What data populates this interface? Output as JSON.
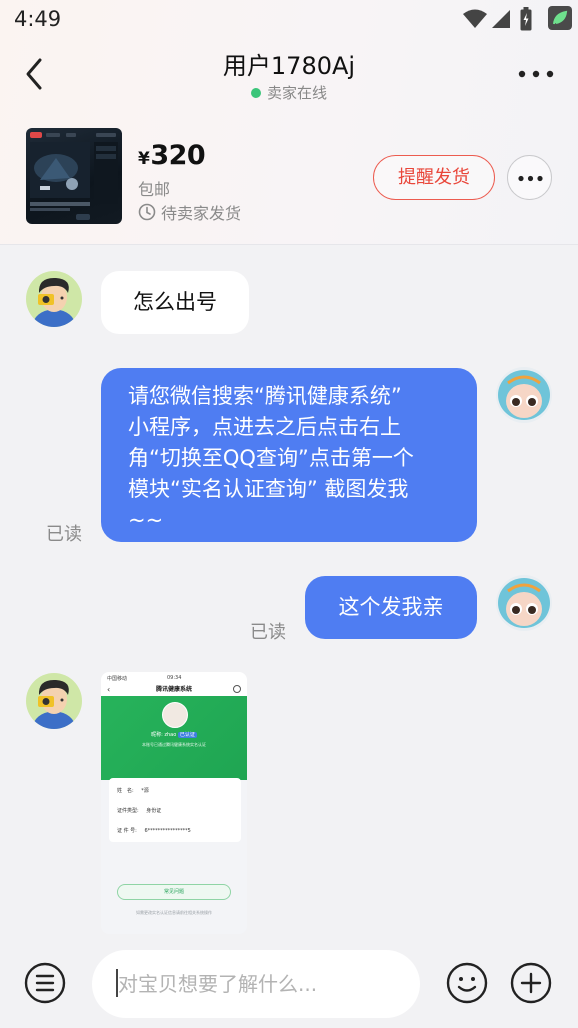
{
  "status_bar": {
    "time": "4:49",
    "icons": [
      "wifi-icon",
      "signal-icon",
      "battery-icon",
      "app-notification-icon"
    ]
  },
  "header": {
    "title": "用户1780Aj",
    "online_status": "卖家在线",
    "online_color": "#3cc57a"
  },
  "product": {
    "currency": "¥",
    "price": "320",
    "shipping": "包邮",
    "status": "待卖家发货",
    "remind_button": "提醒发货",
    "accent": "#e9473b"
  },
  "messages": [
    {
      "from": "seller",
      "type": "text",
      "text": "怎么出号"
    },
    {
      "from": "me",
      "type": "text",
      "lines": [
        "请您微信搜索“腾讯健康系统”",
        "小程序，点进去之后点击右上",
        "角“切换至QQ查询”点击第一个",
        "模块“实名认证查询” 截图发我",
        "~~"
      ],
      "read": "已读"
    },
    {
      "from": "me",
      "type": "text",
      "text": "这个发我亲",
      "read": "已读"
    },
    {
      "from": "seller",
      "type": "image",
      "image": {
        "app_title": "腾讯健康系统",
        "status_time": "09:34",
        "carrier": "中国移动",
        "nickname_label": "昵称:",
        "nickname_value": "zhao",
        "verified_badge": "已认证",
        "desc": "本账号已通过腾讯健康系统实名认证",
        "rows": [
          {
            "label": "姓　名:",
            "value": "*源"
          },
          {
            "label": "证件类型:",
            "value": "身份证"
          },
          {
            "label": "证 件 号:",
            "value": "6****************5"
          }
        ],
        "help_button": "常见问题",
        "footer": "如需更改实名认证信息请前往相关系统操作"
      }
    }
  ],
  "bubble_color": "#4f7df2",
  "input": {
    "placeholder": "对宝贝想要了解什么..."
  }
}
